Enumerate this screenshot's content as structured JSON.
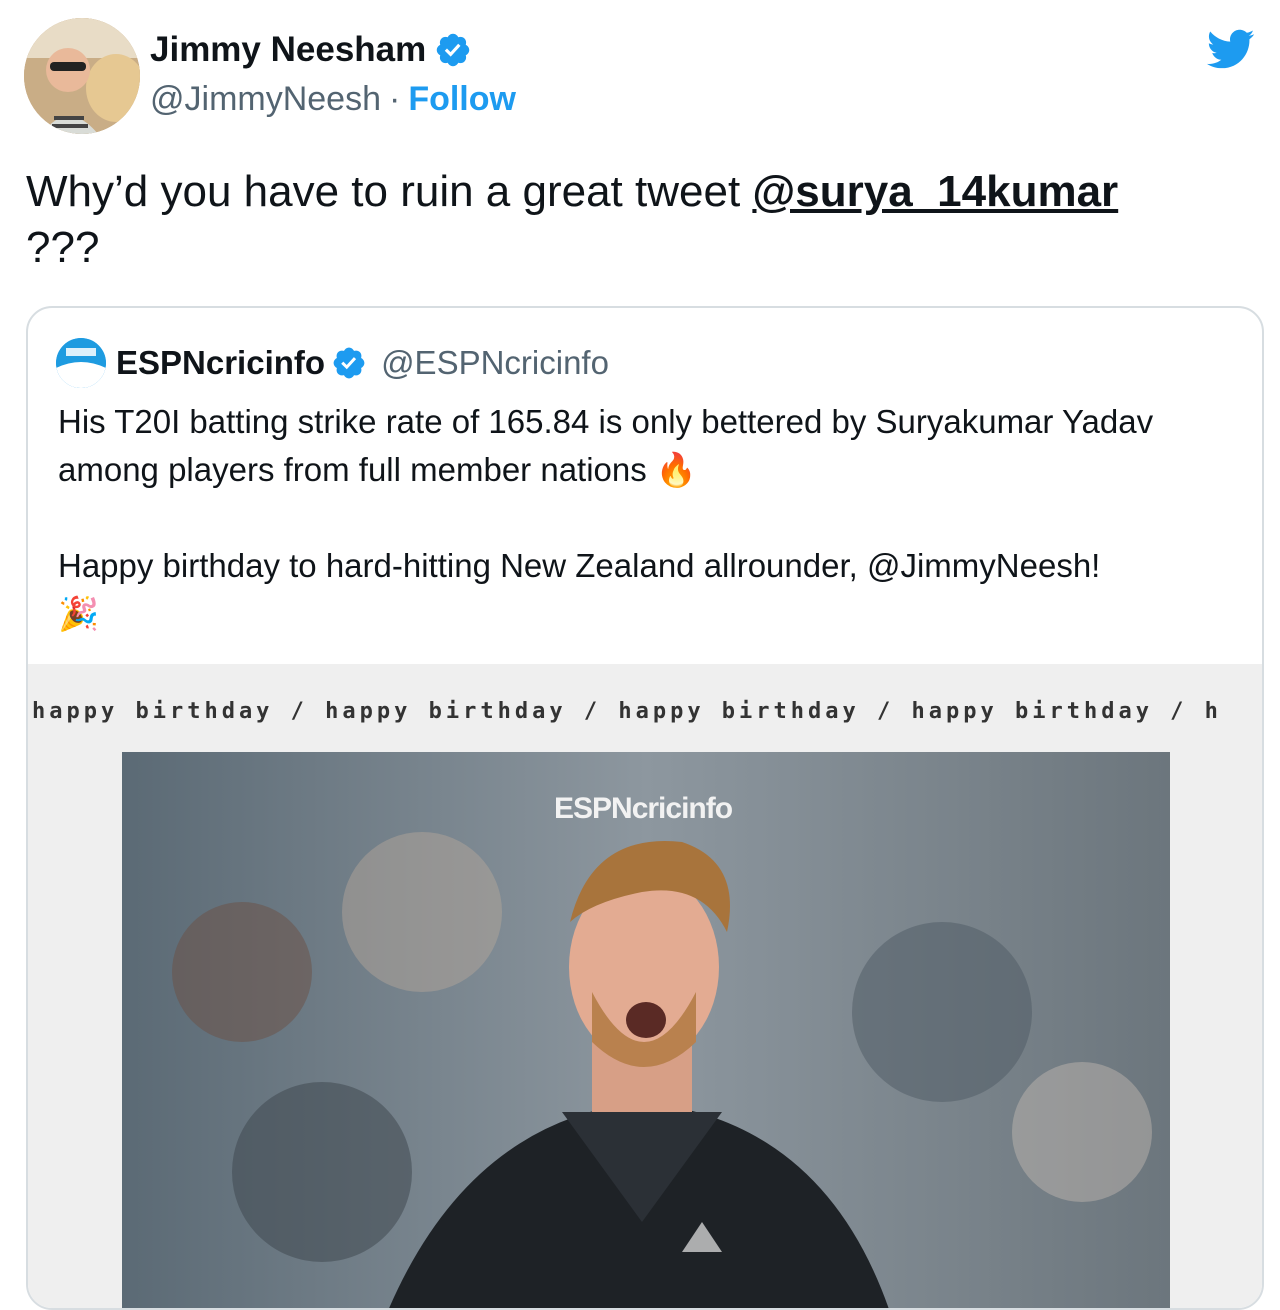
{
  "author": {
    "name": "Jimmy Neesham",
    "handle": "@JimmyNeesh",
    "separator": "·",
    "follow_label": "Follow"
  },
  "tweet": {
    "text_before": "Why’d you have to ruin a great tweet ",
    "mention": "@surya_14kumar",
    "text_after": "???"
  },
  "quoted": {
    "name": "ESPNcricinfo",
    "handle": "@ESPNcricinfo",
    "paragraph1": "His T20I batting strike rate of 165.84 is only bettered by Suryakumar Yadav among players from full member nations",
    "paragraph2": "Happy birthday to hard-hitting New Zealand allrounder, @JimmyNeesh!",
    "emoji_fire": "🔥",
    "emoji_party": "🎉",
    "banner_text": "happy birthday / happy birthday / happy birthday / happy birthday / h",
    "photo_logo": "ESPNcricinfo"
  },
  "colors": {
    "accent": "#1d9bf0",
    "text": "#0f1419",
    "muted": "#536471",
    "border": "#d7dde1"
  },
  "icons": {
    "verified": "verified-badge-icon",
    "logo": "twitter-bird-icon"
  }
}
